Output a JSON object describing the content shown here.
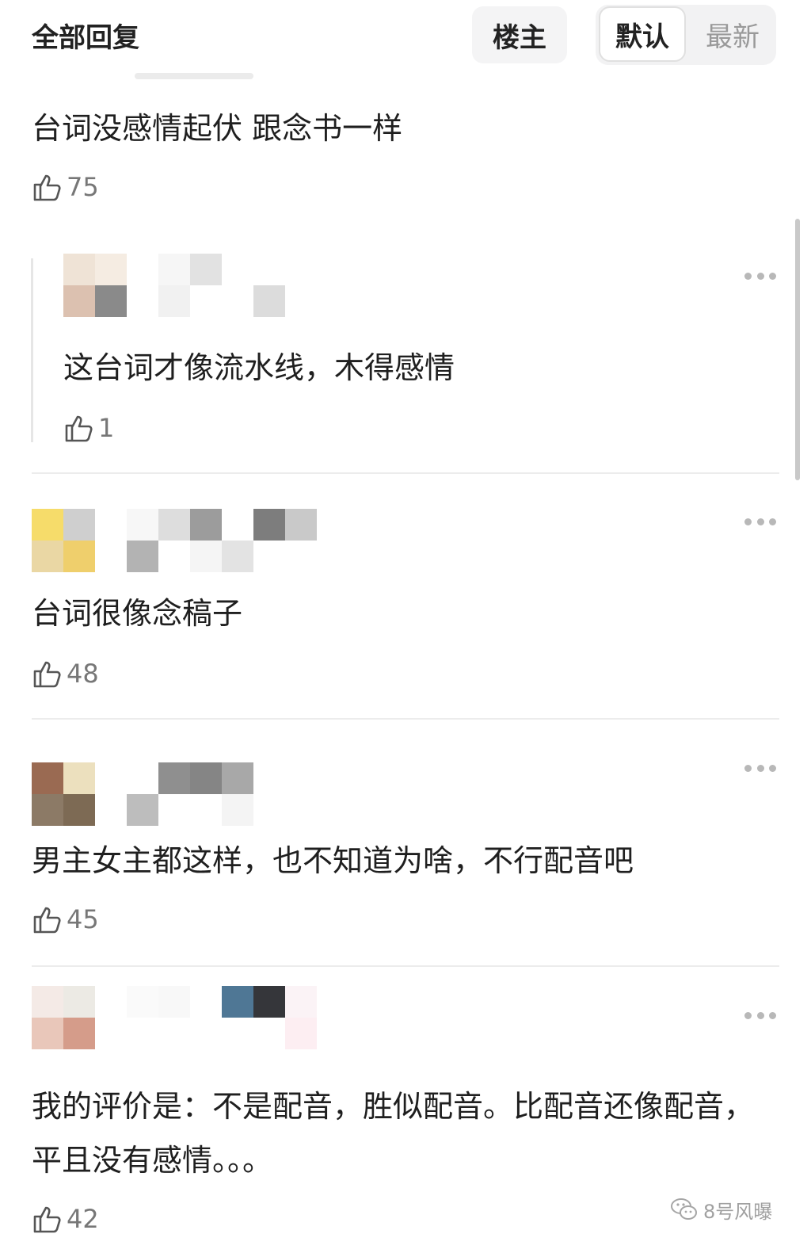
{
  "header": {
    "title": "全部回复",
    "owner_button": "楼主",
    "sort_default": "默认",
    "sort_latest": "最新"
  },
  "comments": [
    {
      "text": "台词没感情起伏 跟念书一样",
      "likes": "75",
      "reply": {
        "text": "这台词才像流水线，木得感情",
        "likes": "1",
        "avatar_colors": [
          "#efe3d6",
          "#f5ece2",
          "#dcc1b0",
          "#8a8a8a"
        ]
      }
    },
    {
      "text": "台词很像念稿子",
      "likes": "48",
      "avatar_colors": [
        "#f6dc6a",
        "#cfcfcf",
        "#ead7a4",
        "#efcf6c"
      ]
    },
    {
      "text": "男主女主都这样，也不知道为啥，不行配音吧",
      "likes": "45",
      "avatar_colors": [
        "#9a6a52",
        "#ece0be",
        "#8c7a66",
        "#7d6a54"
      ]
    },
    {
      "text": "我的评价是：不是配音，胜似配音。比配音还像配音，平且没有感情。。。",
      "likes": "42",
      "avatar_colors": [
        "#f4eae6",
        "#eceae4",
        "#e9c7ba",
        "#d59c8a"
      ]
    }
  ],
  "watermark": {
    "text": "8号风曝",
    "icon": "wechat-icon"
  },
  "icons": {
    "like": "thumbs-up-icon",
    "more": "more-dots-icon"
  },
  "colors": {
    "text": "#1f1f1f",
    "muted": "#777777",
    "divider": "#ececec"
  }
}
